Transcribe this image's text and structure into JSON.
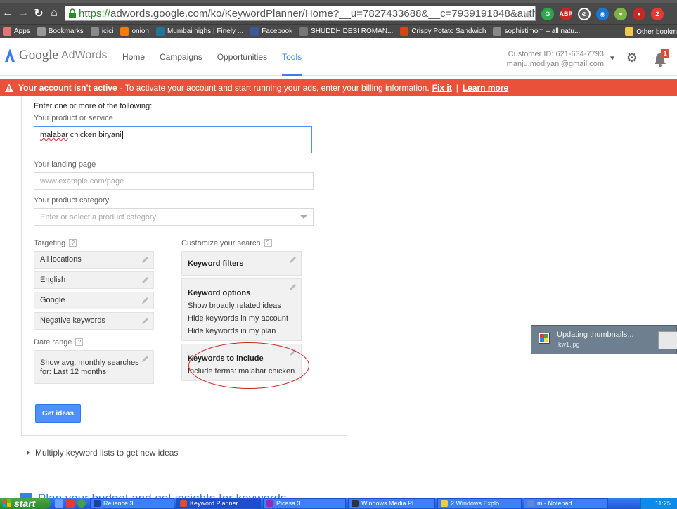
{
  "browser": {
    "url_scheme": "https://",
    "url_rest": "adwords.google.com/ko/KeywordPlanner/Home?__u=7827433688&__c=7939191848&authu",
    "back_icon": "arrow-left-icon",
    "bookmarks": [
      {
        "label": "Apps",
        "icon": "apps-icon",
        "color": "#e57373"
      },
      {
        "label": "Bookmarks",
        "icon": "star-icon",
        "color": "#999999"
      },
      {
        "label": "icici",
        "icon": "bank-icon",
        "color": "#8a8a8a"
      },
      {
        "label": "onion",
        "icon": "blogger-icon",
        "color": "#f57c00"
      },
      {
        "label": "Mumbai highs | Finely ...",
        "icon": "wordpress-icon",
        "color": "#21759b"
      },
      {
        "label": "Facebook",
        "icon": "facebook-icon",
        "color": "#3b5998"
      },
      {
        "label": "SHUDDH DESI ROMAN...",
        "icon": "film-icon",
        "color": "#777777"
      },
      {
        "label": "Crispy Potato Sandwich",
        "icon": "recipe-icon",
        "color": "#d84315"
      },
      {
        "label": "sophistimom – all natu...",
        "icon": "page-icon",
        "color": "#888888"
      }
    ],
    "other_bookmarks": "Other bookm"
  },
  "header": {
    "logo_google": "Google",
    "logo_product": "AdWords",
    "nav": [
      {
        "label": "Home",
        "active": false
      },
      {
        "label": "Campaigns",
        "active": false
      },
      {
        "label": "Opportunities",
        "active": false
      },
      {
        "label": "Tools",
        "active": true
      }
    ],
    "customer_id": "Customer ID: 621-634-7793",
    "email": "manju.modiyani@gmail.com",
    "notification_count": "1"
  },
  "alert": {
    "title": "Your account isn't active",
    "message": "- To activate your account and start running your ads, enter your billing information.",
    "fix_link": "Fix it",
    "separator": "|",
    "learn_link": "Learn more"
  },
  "form": {
    "intro": "Enter one or more of the following:",
    "product_label": "Your product or service",
    "product_word_misspelled": "malabar",
    "product_rest": " chicken biryani",
    "landing_label": "Your landing page",
    "landing_placeholder": "www.example.com/page",
    "category_label": "Your product category",
    "category_placeholder": "Enter or select a product category",
    "targeting_label": "Targeting",
    "help_glyph": "?",
    "targeting_items": [
      "All locations",
      "English",
      "Google",
      "Negative keywords"
    ],
    "date_range_label": "Date range",
    "date_range_line1": "Show avg. monthly searches",
    "date_range_line2": "for: Last 12 months",
    "customize_label": "Customize your search",
    "keyword_filters": "Keyword filters",
    "keyword_options_title": "Keyword options",
    "keyword_options_lines": [
      "Show broadly related ideas",
      "Hide keywords in my account",
      "Hide keywords in my plan"
    ],
    "include_title": "Keywords to include",
    "include_line": "Include terms: malabar chicken",
    "get_ideas": "Get ideas"
  },
  "below": {
    "multiply": "Multiply keyword lists to get new ideas",
    "plan_title": "Plan your budget and get insights for keywords"
  },
  "notification": {
    "title": "Updating thumbnails...",
    "file": "kw1.jpg"
  },
  "taskbar": {
    "start": "start",
    "tasks": [
      {
        "label": "Reliance 3",
        "color": "#1e3fa0",
        "width": 120,
        "active": false
      },
      {
        "label": "Keyword Planner ...",
        "color": "#dd4b39",
        "width": 120,
        "active": true
      },
      {
        "label": "Picasa 3",
        "color": "#9c27b0",
        "width": 118,
        "active": false
      },
      {
        "label": "Windows Media Pl...",
        "color": "#333333",
        "width": 124,
        "active": false
      },
      {
        "label": "2 Windows Explo...",
        "color": "#f2c94c",
        "width": 120,
        "active": false
      },
      {
        "label": "m - Notepad",
        "color": "#5b8bd6",
        "width": 120,
        "active": false
      }
    ],
    "clock": "11:25"
  }
}
